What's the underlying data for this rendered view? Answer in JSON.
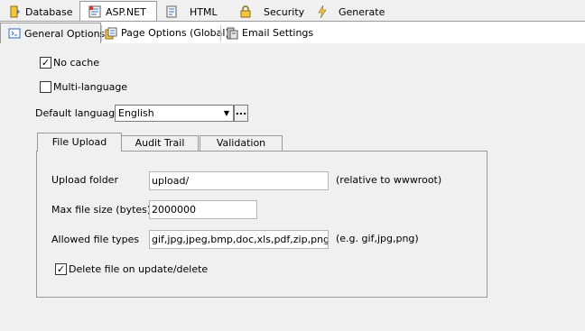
{
  "main_tabs": [
    {
      "label": "Database",
      "icon": "database-icon"
    },
    {
      "label": "ASP.NET",
      "icon": "aspnet-icon",
      "active": true
    },
    {
      "label": "HTML",
      "icon": "html-icon"
    },
    {
      "label": "Security",
      "icon": "lock-icon"
    },
    {
      "label": "Generate",
      "icon": "lightning-icon"
    }
  ],
  "sub_tabs": [
    {
      "label": "General Options",
      "icon": "general-options-icon",
      "active": true
    },
    {
      "label": "Page Options (Global)",
      "icon": "page-options-icon"
    },
    {
      "label": "Email Settings",
      "icon": "email-settings-icon"
    }
  ],
  "general": {
    "no_cache_label": "No cache",
    "no_cache_checked": true,
    "multi_language_label": "Multi-language",
    "multi_language_checked": false,
    "default_language_label": "Default language",
    "default_language_value": "English",
    "ellipsis_label": "..."
  },
  "inner_tabs": [
    {
      "label": "File Upload",
      "active": true
    },
    {
      "label": "Audit Trail"
    },
    {
      "label": "Validation"
    }
  ],
  "file_upload": {
    "upload_folder_label": "Upload folder",
    "upload_folder_value": "upload/",
    "upload_folder_hint": "(relative to wwwroot)",
    "max_size_label": "Max file size (bytes)",
    "max_size_value": "2000000",
    "allowed_types_label": "Allowed file types",
    "allowed_types_value": "gif,jpg,jpeg,bmp,doc,xls,pdf,zip,png",
    "allowed_types_hint": "(e.g. gif,jpg,png)",
    "delete_on_update_label": "Delete file on update/delete",
    "delete_on_update_checked": true
  },
  "colors": {
    "background": "#f0f0f0",
    "border": "#9a9a9a",
    "input_background": "#ffffff"
  }
}
